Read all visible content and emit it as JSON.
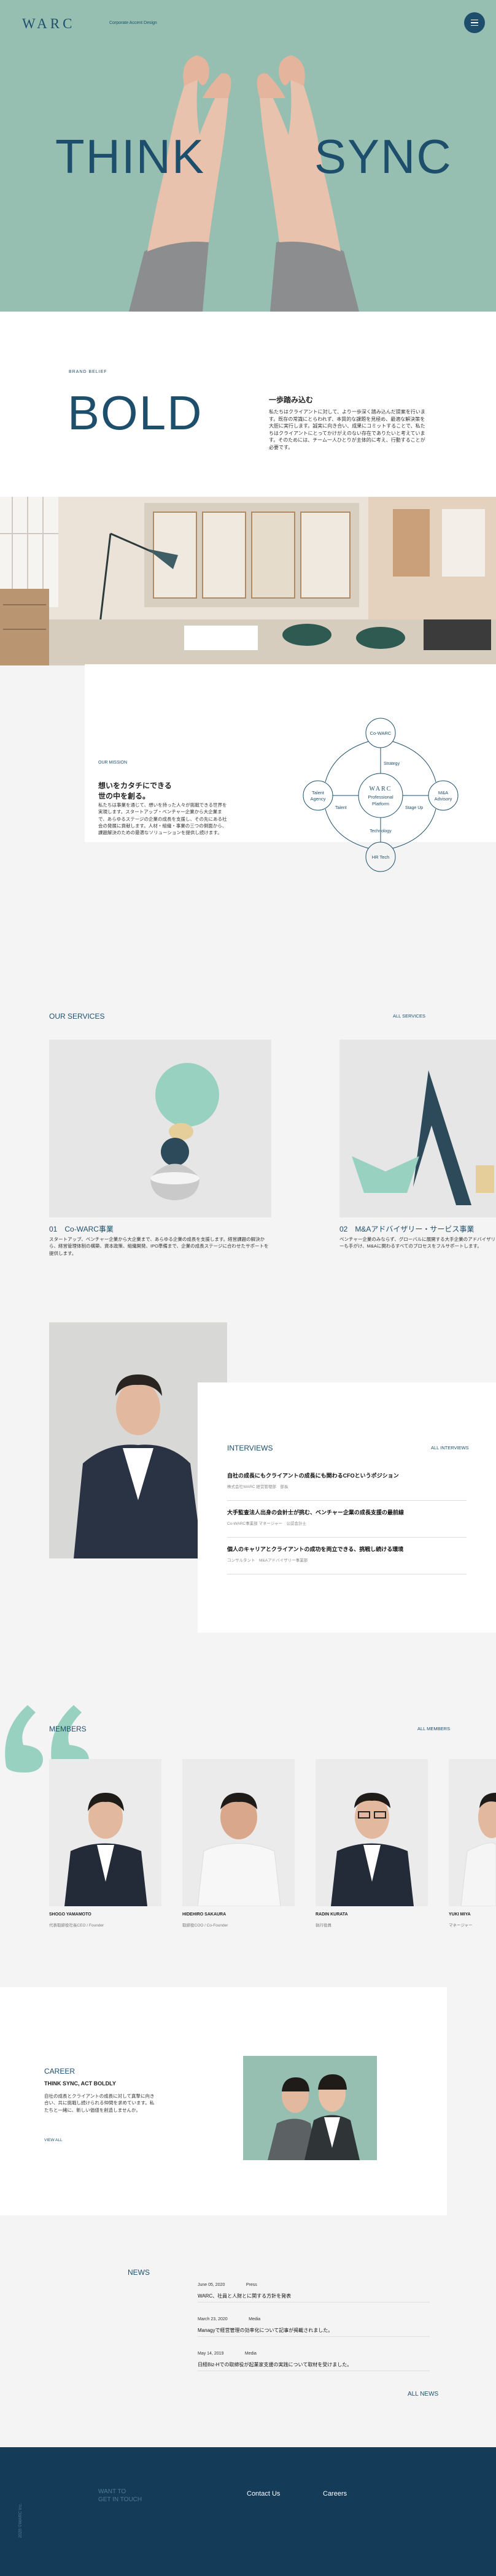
{
  "header": {
    "logo": "WARC",
    "logo_sub": "Corporate Accent Design"
  },
  "hero": {
    "word_left": "THINK",
    "word_right": "SYNC"
  },
  "bold_section": {
    "label": "BRAND BELIEF",
    "title": "BOLD",
    "heading": "一歩踏み込む",
    "body": "私たちはクライアントに対して、より一歩深く踏み込んだ提案を行います。既存の常識にとらわれず、本質的な課題を見極め、最適な解決策を大胆に実行します。誠実に向き合い、成果にコミットすることで、私たちはクライアントにとってかけがえのない存在でありたいと考えています。そのためには、チーム一人ひとりが主体的に考え、行動することが必要です。"
  },
  "mission": {
    "label": "OUR MISSION",
    "heading": "想いをカタチにできる\n世の中を創る。",
    "body": "私たちは事業を通じて、想いを持った人々が挑戦できる世界を実現します。スタートアップ・ベンチャー企業から大企業まで、あらゆるステージの企業の成長を支援し、その先にある社会の発展に貢献します。人材・組織・事業の三つの側面から、課題解決のための最適なソリューションを提供し続けます。",
    "diagram": {
      "center_brand": "WARC",
      "center_line1": "Professional",
      "center_line2": "Platform",
      "node_top": "Co-WARC",
      "node_left_1": "Talent",
      "node_left_2": "Agency",
      "node_right_1": "M&A",
      "node_right_2": "Advisory",
      "node_bottom": "HR Tech",
      "label_strategy": "Strategy",
      "label_talent": "Talent",
      "label_stage_up": "Stage Up",
      "label_technology": "Technology"
    }
  },
  "services": {
    "title": "OUR SERVICES",
    "all_link": "ALL SERVICES",
    "items": [
      {
        "title": "01　Co-WARC事業",
        "body": "スタートアップ、ベンチャー企業から大企業まで、あらゆる企業の成長を支援します。経営課題の解決から、経営管理体制の構築、資本政策、組織開発、IPO準備まで、企業の成長ステージに合わせたサポートを提供します。"
      },
      {
        "title": "02　M&Aアドバイザリー・サービス事業",
        "body": "ベンチャー企業のみならず、グローバルに展開する大手企業のアドバイザリーも手がけ、M&Aに関わるすべてのプロセスをフルサポートします。"
      }
    ]
  },
  "interviews": {
    "title": "INTERVIEWS",
    "all_link": "ALL INTERVIEWS",
    "items": [
      {
        "title": "自社の成長にもクライアントの成長にも関わるCFOというポジション",
        "sub": "株式会社WARC 経営管理部　部長"
      },
      {
        "title": "大手監査法人出身の会計士が挑む、ベンチャー企業の成長支援の最前線",
        "sub": "Co-WARC事業部 マネージャー　公認会計士"
      },
      {
        "title": "個人のキャリアとクライアントの成功を両立できる、挑戦し続ける環境",
        "sub": "コンサルタント　M&Aアドバイザリー事業部"
      }
    ]
  },
  "members": {
    "title": "MEMBERS",
    "all_link": "ALL MEMBERS",
    "items": [
      {
        "name": "SHOGO YAMAMOTO",
        "role": "代表取締役社長CEO / Founder"
      },
      {
        "name": "HIDEHIRO SAKAURA",
        "role": "取締役COO / Co-Founder"
      },
      {
        "name": "RADIN KURATA",
        "role": "執行役員"
      },
      {
        "name": "YUKI MIYA",
        "role": "マネージャー"
      }
    ]
  },
  "career": {
    "title": "CAREER",
    "heading": "THINK SYNC, ACT BOLDLY",
    "body": "自社の成長とクライアントの成長に対して真摯に向き合い、共に挑戦し続けられる仲間を求めています。私たちと一緒に、新しい価値を創造しませんか。",
    "link": "VIEW ALL"
  },
  "news": {
    "title": "NEWS",
    "all_link": "ALL NEWS",
    "items": [
      {
        "date": "June 05, 2020",
        "category": "Press",
        "title": "WARC、社員と人財とに関する方針を発表"
      },
      {
        "date": "March 23, 2020",
        "category": "Media",
        "title": "Managyで経営管理の効率化について記事が掲載されました。"
      },
      {
        "date": "May 14, 2019",
        "category": "Media",
        "title": "日経Biz-Hでの取締役が起業家支援の実践について取材を受けました。"
      }
    ]
  },
  "footer": {
    "contact_line1": "WANT TO",
    "contact_line2": "GET IN TOUCH",
    "link_contact": "Contact Us",
    "link_careers": "Careers",
    "copyright": "2020 ©WARC Inc."
  },
  "colors": {
    "brand_navy": "#1d4f6c",
    "hero_mint": "#96bfb2",
    "footer_navy": "#143b58"
  }
}
